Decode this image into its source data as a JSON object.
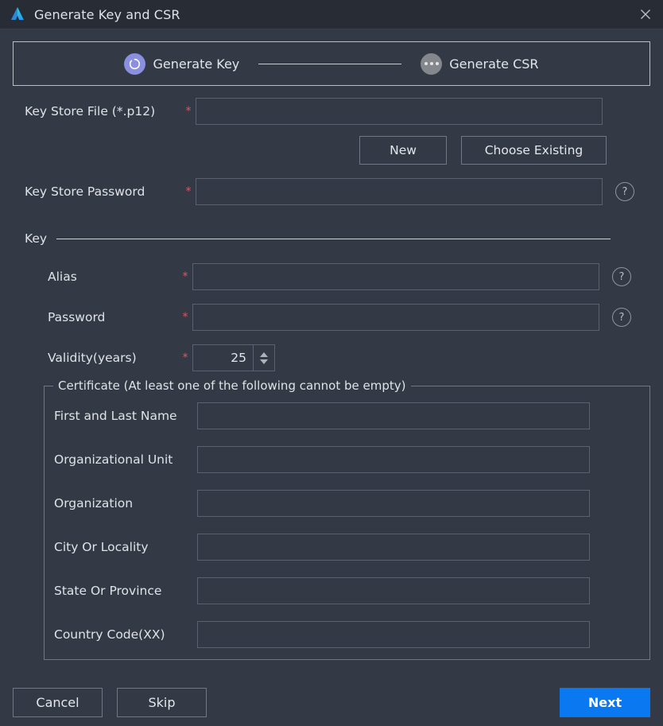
{
  "window": {
    "title": "Generate Key and CSR",
    "app_icon": "android-studio-logo-icon",
    "close_icon": "close-icon"
  },
  "stepper": {
    "steps": [
      {
        "label": "Generate Key",
        "state": "active",
        "icon": "spinner-ring-icon"
      },
      {
        "label": "Generate CSR",
        "state": "inactive",
        "icon": "ellipsis-icon"
      }
    ],
    "active_color": "#8b8fe0",
    "inactive_color": "#84878c"
  },
  "form": {
    "key_store_file": {
      "label": "Key Store File (*.p12)",
      "required_marker": "*",
      "value": "",
      "placeholder": ""
    },
    "new_button": "New",
    "choose_existing_button": "Choose Existing",
    "key_store_password": {
      "label": "Key Store Password",
      "required_marker": "*",
      "value": "",
      "placeholder": "",
      "help_icon": "help-circle-icon"
    },
    "key_group": {
      "title": "Key",
      "alias": {
        "label": "Alias",
        "required_marker": "*",
        "value": "",
        "placeholder": "",
        "help_icon": "help-circle-icon"
      },
      "password": {
        "label": "Password",
        "required_marker": "*",
        "value": "",
        "placeholder": "",
        "help_icon": "help-circle-icon"
      },
      "validity": {
        "label": "Validity(years)",
        "required_marker": "*",
        "value": "25"
      }
    },
    "certificate_group": {
      "legend": "Certificate (At least one of the following cannot be empty)",
      "fields": [
        {
          "label": "First and Last Name",
          "value": "",
          "placeholder": ""
        },
        {
          "label": "Organizational Unit",
          "value": "",
          "placeholder": ""
        },
        {
          "label": "Organization",
          "value": "",
          "placeholder": ""
        },
        {
          "label": "City Or Locality",
          "value": "",
          "placeholder": ""
        },
        {
          "label": "State Or Province",
          "value": "",
          "placeholder": ""
        },
        {
          "label": "Country Code(XX)",
          "value": "",
          "placeholder": ""
        }
      ]
    }
  },
  "footer": {
    "cancel_label": "Cancel",
    "skip_label": "Skip",
    "next_label": "Next",
    "next_color": "#0a78f0"
  }
}
